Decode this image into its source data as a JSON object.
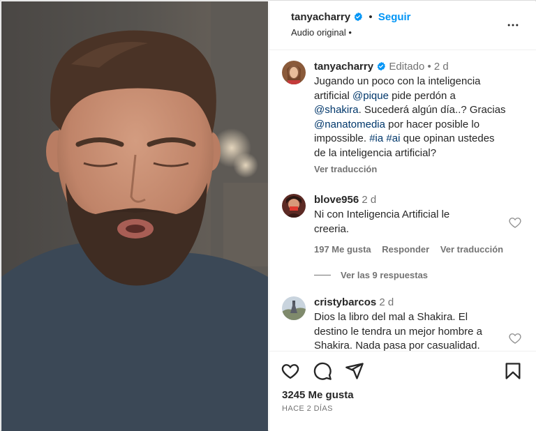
{
  "post": {
    "author": "tanyacharry",
    "follow_label": "Seguir",
    "audio_label": "Audio original",
    "audio_dot": "•"
  },
  "caption": {
    "user": "tanyacharry",
    "edited": "Editado",
    "separator": "•",
    "time": "2 d",
    "line1": "Jugando un poco con la inteligencia",
    "line2_a": "artificial ",
    "mention_pique": "@pique",
    "line2_b": " pide perdón a",
    "mention_shakira": "@shakira",
    "line3_b": ". Sucederá algún día..? Gracias",
    "mention_nanato": "@nanatomedia",
    "line4_b": " por hacer posible lo",
    "line5_a": "impossible. ",
    "tag_ia": "#ia",
    "tag_ai": "#ai",
    "line5_b": " que opinan ustedes",
    "line6": "de la inteligencia artificial?",
    "translate": "Ver traducción"
  },
  "comments": [
    {
      "user": "blove956",
      "time": "2 d",
      "line1": "Ni con Inteligencia Artificial le",
      "line2": "creeria.",
      "likes": "197 Me gusta",
      "reply": "Responder",
      "translate": "Ver traducción",
      "replies": "Ver las 9 respuestas"
    },
    {
      "user": "cristybarcos",
      "time": "2 d",
      "line1": "Dios la libro del mal a Shakira. El",
      "line2": "destino le tendra un mejor hombre a",
      "line3": "Shakira. Nada pasa por casualidad."
    }
  ],
  "footer": {
    "likes": "3245 Me gusta",
    "ago": "HACE 2 DÍAS"
  },
  "colors": {
    "link_blue": "#0095f6",
    "mention_blue": "#00376b",
    "verified_blue": "#0095f6",
    "muted_text": "#737373"
  },
  "icons": [
    "verified-icon",
    "more-options-icon",
    "heart-icon",
    "comment-icon",
    "share-icon",
    "bookmark-icon"
  ]
}
